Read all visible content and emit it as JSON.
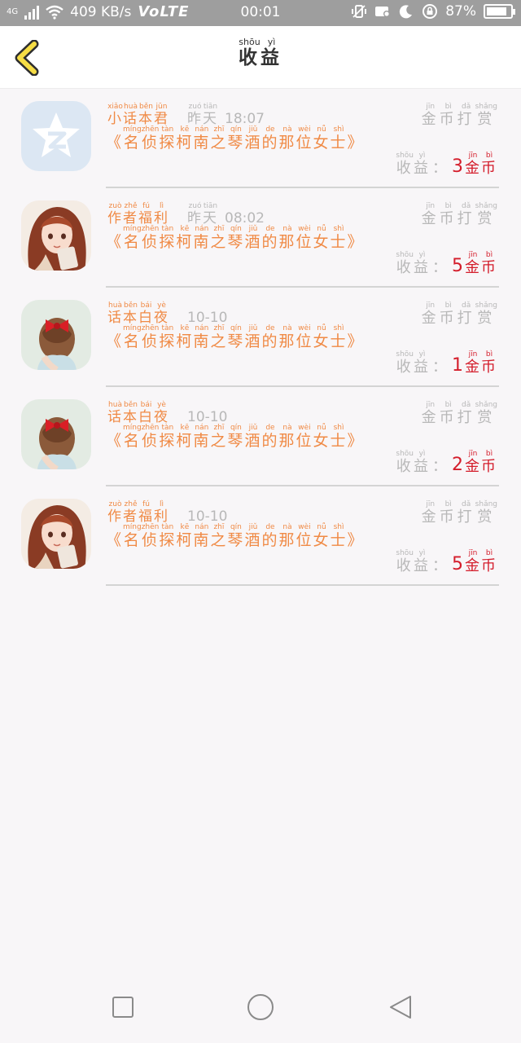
{
  "status_bar": {
    "network": "4G",
    "speed": "409 KB/s",
    "volte": "VoLTE",
    "time": "00:01",
    "battery_text": "87%",
    "battery_level": 0.87
  },
  "header": {
    "title": [
      {
        "h": "收",
        "p": "shōu"
      },
      {
        "h": "益",
        "p": "yì"
      }
    ]
  },
  "colors": {
    "accent_orange": "#f08a45",
    "amount_red": "#d41d2b",
    "muted_gray": "#b8b8b8"
  },
  "items": [
    {
      "avatar": "qq-zone-logo",
      "author": [
        {
          "h": "小",
          "p": "xiǎo"
        },
        {
          "h": "话",
          "p": "huà"
        },
        {
          "h": "本",
          "p": "běn"
        },
        {
          "h": "君",
          "p": "jūn"
        }
      ],
      "time_word": [
        {
          "h": "昨",
          "p": "zuó"
        },
        {
          "h": "天",
          "p": "tiān"
        }
      ],
      "time": "18:07",
      "work_title": [
        {
          "h": "《",
          "p": ""
        },
        {
          "h": "名",
          "p": "míng"
        },
        {
          "h": "侦",
          "p": "zhēn"
        },
        {
          "h": "探",
          "p": "tàn"
        },
        {
          "h": "柯",
          "p": "kē"
        },
        {
          "h": "南",
          "p": "nán"
        },
        {
          "h": "之",
          "p": "zhī"
        },
        {
          "h": "琴",
          "p": "qín"
        },
        {
          "h": "酒",
          "p": "jiǔ"
        },
        {
          "h": "的",
          "p": "de"
        },
        {
          "h": "那",
          "p": "nà"
        },
        {
          "h": "位",
          "p": "wèi"
        },
        {
          "h": "女",
          "p": "nǚ"
        },
        {
          "h": "士",
          "p": "shì"
        },
        {
          "h": "》",
          "p": ""
        }
      ],
      "tip": [
        {
          "h": "金",
          "p": "jīn"
        },
        {
          "h": "币",
          "p": "bì"
        },
        {
          "h": "打",
          "p": "dǎ"
        },
        {
          "h": "赏",
          "p": "shǎng"
        }
      ],
      "earn_label": [
        {
          "h": "收",
          "p": "shōu"
        },
        {
          "h": "益",
          "p": "yì"
        }
      ],
      "colon": "：",
      "amount": "3",
      "unit": [
        {
          "h": "金",
          "p": "jīn"
        },
        {
          "h": "币",
          "p": "bì"
        }
      ]
    },
    {
      "avatar": "anime-girl-avatar",
      "author": [
        {
          "h": "作",
          "p": "zuò"
        },
        {
          "h": "者",
          "p": "zhě"
        },
        {
          "h": "福",
          "p": "fú"
        },
        {
          "h": "利",
          "p": "lì"
        }
      ],
      "time_word": [
        {
          "h": "昨",
          "p": "zuó"
        },
        {
          "h": "天",
          "p": "tiān"
        }
      ],
      "time": "08:02",
      "work_title": [
        {
          "h": "《",
          "p": ""
        },
        {
          "h": "名",
          "p": "míng"
        },
        {
          "h": "侦",
          "p": "zhēn"
        },
        {
          "h": "探",
          "p": "tàn"
        },
        {
          "h": "柯",
          "p": "kē"
        },
        {
          "h": "南",
          "p": "nán"
        },
        {
          "h": "之",
          "p": "zhī"
        },
        {
          "h": "琴",
          "p": "qín"
        },
        {
          "h": "酒",
          "p": "jiǔ"
        },
        {
          "h": "的",
          "p": "de"
        },
        {
          "h": "那",
          "p": "nà"
        },
        {
          "h": "位",
          "p": "wèi"
        },
        {
          "h": "女",
          "p": "nǚ"
        },
        {
          "h": "士",
          "p": "shì"
        },
        {
          "h": "》",
          "p": ""
        }
      ],
      "tip": [
        {
          "h": "金",
          "p": "jīn"
        },
        {
          "h": "币",
          "p": "bì"
        },
        {
          "h": "打",
          "p": "dǎ"
        },
        {
          "h": "赏",
          "p": "shǎng"
        }
      ],
      "earn_label": [
        {
          "h": "收",
          "p": "shōu"
        },
        {
          "h": "益",
          "p": "yì"
        }
      ],
      "colon": "：",
      "amount": "5",
      "unit": [
        {
          "h": "金",
          "p": "jīn"
        },
        {
          "h": "币",
          "p": "bì"
        }
      ]
    },
    {
      "avatar": "bow-hair-girl-avatar",
      "author": [
        {
          "h": "话",
          "p": "huà"
        },
        {
          "h": "本",
          "p": "běn"
        },
        {
          "h": "白",
          "p": "bái"
        },
        {
          "h": "夜",
          "p": "yè"
        }
      ],
      "time_word": [],
      "time": "10-10",
      "work_title": [
        {
          "h": "《",
          "p": ""
        },
        {
          "h": "名",
          "p": "míng"
        },
        {
          "h": "侦",
          "p": "zhēn"
        },
        {
          "h": "探",
          "p": "tàn"
        },
        {
          "h": "柯",
          "p": "kē"
        },
        {
          "h": "南",
          "p": "nán"
        },
        {
          "h": "之",
          "p": "zhī"
        },
        {
          "h": "琴",
          "p": "qín"
        },
        {
          "h": "酒",
          "p": "jiǔ"
        },
        {
          "h": "的",
          "p": "de"
        },
        {
          "h": "那",
          "p": "nà"
        },
        {
          "h": "位",
          "p": "wèi"
        },
        {
          "h": "女",
          "p": "nǚ"
        },
        {
          "h": "士",
          "p": "shì"
        },
        {
          "h": "》",
          "p": ""
        }
      ],
      "tip": [
        {
          "h": "金",
          "p": "jīn"
        },
        {
          "h": "币",
          "p": "bì"
        },
        {
          "h": "打",
          "p": "dǎ"
        },
        {
          "h": "赏",
          "p": "shǎng"
        }
      ],
      "earn_label": [
        {
          "h": "收",
          "p": "shōu"
        },
        {
          "h": "益",
          "p": "yì"
        }
      ],
      "colon": "：",
      "amount": "1",
      "unit": [
        {
          "h": "金",
          "p": "jīn"
        },
        {
          "h": "币",
          "p": "bì"
        }
      ]
    },
    {
      "avatar": "bow-hair-girl-avatar",
      "author": [
        {
          "h": "话",
          "p": "huà"
        },
        {
          "h": "本",
          "p": "běn"
        },
        {
          "h": "白",
          "p": "bái"
        },
        {
          "h": "夜",
          "p": "yè"
        }
      ],
      "time_word": [],
      "time": "10-10",
      "work_title": [
        {
          "h": "《",
          "p": ""
        },
        {
          "h": "名",
          "p": "míng"
        },
        {
          "h": "侦",
          "p": "zhēn"
        },
        {
          "h": "探",
          "p": "tàn"
        },
        {
          "h": "柯",
          "p": "kē"
        },
        {
          "h": "南",
          "p": "nán"
        },
        {
          "h": "之",
          "p": "zhī"
        },
        {
          "h": "琴",
          "p": "qín"
        },
        {
          "h": "酒",
          "p": "jiǔ"
        },
        {
          "h": "的",
          "p": "de"
        },
        {
          "h": "那",
          "p": "nà"
        },
        {
          "h": "位",
          "p": "wèi"
        },
        {
          "h": "女",
          "p": "nǚ"
        },
        {
          "h": "士",
          "p": "shì"
        },
        {
          "h": "》",
          "p": ""
        }
      ],
      "tip": [
        {
          "h": "金",
          "p": "jīn"
        },
        {
          "h": "币",
          "p": "bì"
        },
        {
          "h": "打",
          "p": "dǎ"
        },
        {
          "h": "赏",
          "p": "shǎng"
        }
      ],
      "earn_label": [
        {
          "h": "收",
          "p": "shōu"
        },
        {
          "h": "益",
          "p": "yì"
        }
      ],
      "colon": "：",
      "amount": "2",
      "unit": [
        {
          "h": "金",
          "p": "jīn"
        },
        {
          "h": "币",
          "p": "bì"
        }
      ]
    },
    {
      "avatar": "anime-girl-avatar",
      "author": [
        {
          "h": "作",
          "p": "zuò"
        },
        {
          "h": "者",
          "p": "zhě"
        },
        {
          "h": "福",
          "p": "fú"
        },
        {
          "h": "利",
          "p": "lì"
        }
      ],
      "time_word": [],
      "time": "10-10",
      "work_title": [
        {
          "h": "《",
          "p": ""
        },
        {
          "h": "名",
          "p": "míng"
        },
        {
          "h": "侦",
          "p": "zhēn"
        },
        {
          "h": "探",
          "p": "tàn"
        },
        {
          "h": "柯",
          "p": "kē"
        },
        {
          "h": "南",
          "p": "nán"
        },
        {
          "h": "之",
          "p": "zhī"
        },
        {
          "h": "琴",
          "p": "qín"
        },
        {
          "h": "酒",
          "p": "jiǔ"
        },
        {
          "h": "的",
          "p": "de"
        },
        {
          "h": "那",
          "p": "nà"
        },
        {
          "h": "位",
          "p": "wèi"
        },
        {
          "h": "女",
          "p": "nǚ"
        },
        {
          "h": "士",
          "p": "shì"
        },
        {
          "h": "》",
          "p": ""
        }
      ],
      "tip": [
        {
          "h": "金",
          "p": "jīn"
        },
        {
          "h": "币",
          "p": "bì"
        },
        {
          "h": "打",
          "p": "dǎ"
        },
        {
          "h": "赏",
          "p": "shǎng"
        }
      ],
      "earn_label": [
        {
          "h": "收",
          "p": "shōu"
        },
        {
          "h": "益",
          "p": "yì"
        }
      ],
      "colon": "：",
      "amount": "5",
      "unit": [
        {
          "h": "金",
          "p": "jīn"
        },
        {
          "h": "币",
          "p": "bì"
        }
      ]
    }
  ]
}
